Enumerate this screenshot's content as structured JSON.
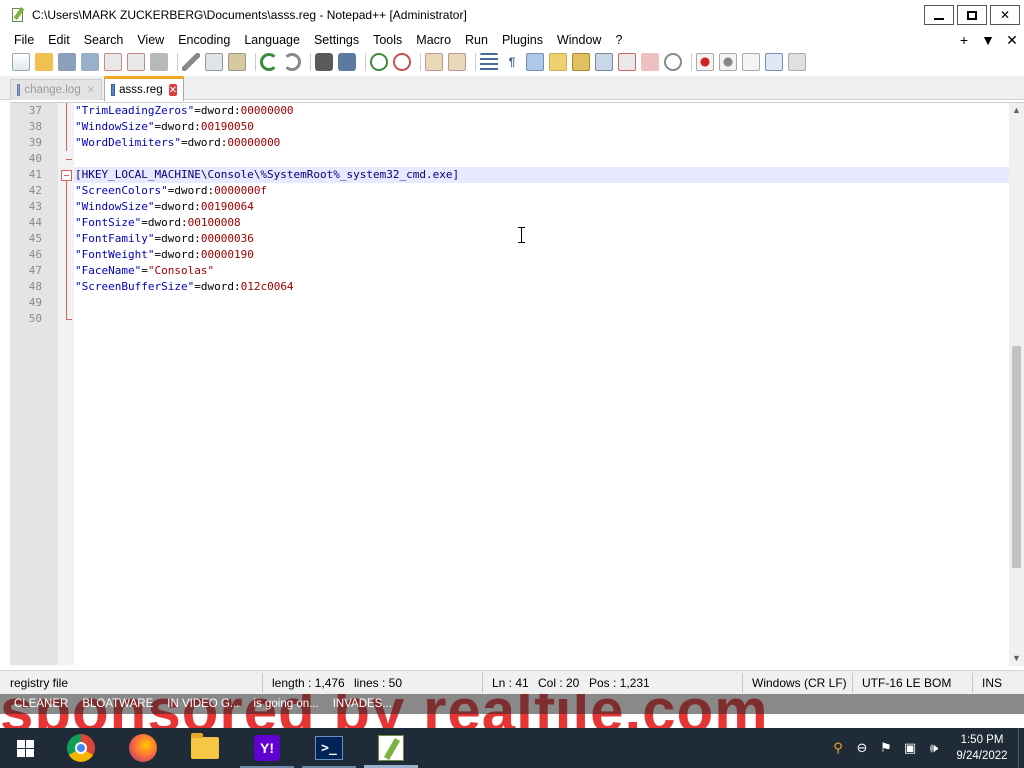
{
  "window": {
    "title": "C:\\Users\\MARK ZUCKERBERG\\Documents\\asss.reg - Notepad++ [Administrator]",
    "controls": {
      "minimize": "",
      "maximize": "",
      "close": "✕"
    }
  },
  "menu": {
    "items": [
      "File",
      "Edit",
      "Search",
      "View",
      "Encoding",
      "Language",
      "Settings",
      "Tools",
      "Macro",
      "Run",
      "Plugins",
      "Window",
      "?"
    ],
    "right": {
      "plus": "+",
      "dropdown": "▼",
      "close": "✕"
    }
  },
  "toolbar": {
    "icons": [
      "new-file-icon",
      "open-file-icon",
      "save-icon",
      "save-all-icon",
      "close-icon",
      "close-all-icon",
      "print-icon",
      "cut-icon",
      "copy-icon",
      "paste-icon",
      "undo-icon",
      "redo-icon",
      "find-icon",
      "replace-icon",
      "zoom-in-icon",
      "zoom-out-icon",
      "sync-vertical-icon",
      "sync-horizontal-icon",
      "word-wrap-icon",
      "show-all-chars-icon",
      "indent-guide-icon",
      "user-language-icon",
      "doc-map-icon",
      "doc-list-icon",
      "function-list-icon",
      "folder-workspace-icon",
      "monitoring-icon",
      "record-macro-icon",
      "stop-macro-icon",
      "play-macro-icon",
      "run-macro-multiple-icon",
      "save-macro-icon"
    ],
    "colors": {
      "selected_bg": "#b0c8e8"
    }
  },
  "tabs": [
    {
      "label": "change.log",
      "active": false
    },
    {
      "label": "asss.reg",
      "active": true
    }
  ],
  "editor": {
    "current_line": 41,
    "lines": [
      {
        "n": "37",
        "k": "\"TrimLeadingZeros\"",
        "eq": "=dword:",
        "v": "00000000"
      },
      {
        "n": "38",
        "k": "\"WindowSize\"",
        "eq": "=dword:",
        "v": "00190050"
      },
      {
        "n": "39",
        "k": "\"WordDelimiters\"",
        "eq": "=dword:",
        "v": "00000000"
      },
      {
        "n": "40",
        "k": "",
        "eq": "",
        "v": ""
      },
      {
        "n": "41",
        "sec": "[HKEY_LOCAL_MACHINE\\Console\\%SystemRoot%_system32_cmd.exe]"
      },
      {
        "n": "42",
        "k": "\"ScreenColors\"",
        "eq": "=dword:",
        "v": "0000000f"
      },
      {
        "n": "43",
        "k": "\"WindowSize\"",
        "eq": "=dword:",
        "v": "00190064"
      },
      {
        "n": "44",
        "k": "\"FontSize\"",
        "eq": "=dword:",
        "v": "00100008"
      },
      {
        "n": "45",
        "k": "\"FontFamily\"",
        "eq": "=dword:",
        "v": "00000036"
      },
      {
        "n": "46",
        "k": "\"FontWeight\"",
        "eq": "=dword:",
        "v": "00000190"
      },
      {
        "n": "47",
        "k": "\"FaceName\"",
        "eq": "=",
        "v": "\"Consolas\""
      },
      {
        "n": "48",
        "k": "\"ScreenBufferSize\"",
        "eq": "=dword:",
        "v": "012c0064"
      },
      {
        "n": "49",
        "k": "",
        "eq": "",
        "v": ""
      },
      {
        "n": "50",
        "k": "",
        "eq": "",
        "v": ""
      }
    ],
    "colors": {
      "key": "#0000c0",
      "value": "#a00000",
      "section": "#000080",
      "fold": "#e06060"
    }
  },
  "status": {
    "file_type": "registry file",
    "length": "length : 1,476",
    "lines": "lines : 50",
    "ln": "Ln : 41",
    "col": "Col : 20",
    "pos": "Pos : 1,231",
    "eol": "Windows (CR LF)",
    "encoding": "UTF-16 LE BOM",
    "mode": "INS"
  },
  "overlay": {
    "ticker": [
      "CLEANER",
      "BLOATWARE",
      "IN VIDEO G...",
      "is going on...",
      "INVADES..."
    ],
    "banner": "sponsored by realfile.com"
  },
  "taskbar": {
    "apps": [
      "chrome-icon",
      "firefox-icon",
      "file-explorer-icon",
      "yahoo-icon",
      "powershell-icon",
      "notepad-plus-plus-icon"
    ],
    "yahoo_glyph": "Y!",
    "powershell_glyph": ">_",
    "clock_time": "1:50 PM",
    "clock_date": "9/24/2022",
    "tray": {
      "search": "⚲",
      "circle": "⊖",
      "flag": "⚑",
      "network": "▣",
      "volume": "🕪"
    }
  }
}
